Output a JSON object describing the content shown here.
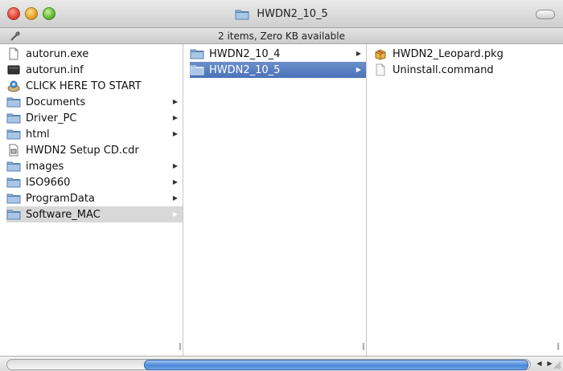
{
  "window": {
    "title": "HWDN2_10_5",
    "status": "2 items, Zero KB available"
  },
  "columns": {
    "col1": [
      {
        "label": "autorun.exe",
        "icon": "document-icon",
        "arrow": false
      },
      {
        "label": "autorun.inf",
        "icon": "black-file-icon",
        "arrow": false
      },
      {
        "label": "CLICK HERE TO START",
        "icon": "app-icon",
        "arrow": false
      },
      {
        "label": "Documents",
        "icon": "folder-icon",
        "arrow": true
      },
      {
        "label": "Driver_PC",
        "icon": "folder-icon",
        "arrow": true
      },
      {
        "label": "html",
        "icon": "folder-icon",
        "arrow": true
      },
      {
        "label": "HWDN2 Setup CD.cdr",
        "icon": "disk-image-icon",
        "arrow": false
      },
      {
        "label": "images",
        "icon": "folder-icon",
        "arrow": true
      },
      {
        "label": "ISO9660",
        "icon": "folder-icon",
        "arrow": true
      },
      {
        "label": "ProgramData",
        "icon": "folder-icon",
        "arrow": true
      },
      {
        "label": "Software_MAC",
        "icon": "folder-icon",
        "arrow": true,
        "selected": "grey"
      }
    ],
    "col2": [
      {
        "label": "HWDN2_10_4",
        "icon": "folder-icon",
        "arrow": true
      },
      {
        "label": "HWDN2_10_5",
        "icon": "folder-icon",
        "arrow": true,
        "selected": "blue"
      }
    ],
    "col3": [
      {
        "label": "HWDN2_Leopard.pkg",
        "icon": "package-icon",
        "arrow": false
      },
      {
        "label": "Uninstall.command",
        "icon": "script-icon",
        "arrow": false
      }
    ]
  },
  "colors": {
    "selection_blue": "#4a72b8",
    "selection_grey": "#d8d8d8",
    "folder": "#8eb3d9"
  }
}
